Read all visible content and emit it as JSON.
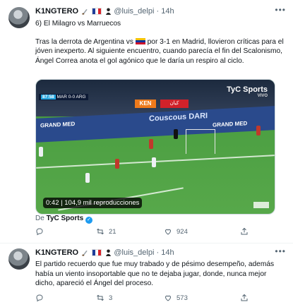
{
  "tweets": [
    {
      "author": "K1NGTERO",
      "handle": "@luis_delpi",
      "dot": "·",
      "time": "14h",
      "text": {
        "line_title": "6) El Milagro vs Marruecos",
        "p1": "Tras la derrota de Argentina vs",
        "p2": "por 3-1 en Madrid, llovieron críticas para el jóven inexperto. Al siguiente encuentro, cuando parecía el fin del Scalonismo, Ángel Correa anota el gol agónico que le daría un respiro al ciclo."
      },
      "media": {
        "views_badge_time": "0:42",
        "views_badge_text": "104,9 mil reproducciones",
        "broadcaster_logo": "TyC Sports",
        "broadcaster_sub": "VIVO",
        "score_text": "MAR 0-0 ARG",
        "clock_text": "87:58",
        "ad_ken": "KEN",
        "ad_red": "كيان",
        "ad_center": "Couscous DARI",
        "ad_left": "GRAND MED",
        "ad_right": "GRAND MED"
      },
      "source": {
        "prefix": "De",
        "name": "TyC Sports"
      },
      "stats": {
        "replies": "",
        "retweets": "21",
        "likes": "924"
      }
    },
    {
      "author": "K1NGTERO",
      "handle": "@luis_delpi",
      "dot": "·",
      "time": "14h",
      "text": "El partido recuerdo que fue muy trabado y de pésimo desempeño, además había un viento insoportable que no te dejaba jugar, donde, nunca mejor dicho, apareció el Ángel del proceso.",
      "stats": {
        "replies": "",
        "retweets": "3",
        "likes": "573"
      }
    }
  ],
  "icons": {
    "more": "more-horizontal-icon",
    "verified": "verified-badge-icon",
    "reply": "reply-icon",
    "retweet": "retweet-icon",
    "like": "heart-icon",
    "share": "share-icon",
    "flag_venezuela": "venezuela-flag-icon",
    "flag_france": "france-flag-icon",
    "knife": "knife-emoji-icon",
    "person": "person-emoji-icon"
  }
}
